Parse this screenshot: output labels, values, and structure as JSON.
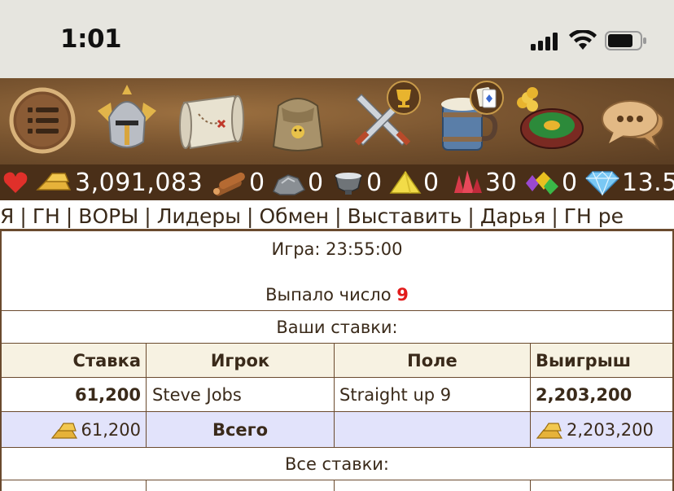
{
  "status_bar": {
    "time": "1:01"
  },
  "toolbar": {
    "icons": [
      "menu-icon",
      "knight-helmet-icon",
      "treasure-map-icon",
      "backpack-icon",
      "crossed-swords-icon",
      "tavern-mug-icon",
      "roulette-icon",
      "chat-icon"
    ],
    "badges": [
      "trophy-badge-icon",
      "cards-badge-icon"
    ]
  },
  "resources": {
    "gold": "3,091,083",
    "wood": "0",
    "stone": "0",
    "mercury": "0",
    "sulfur": "0",
    "crystal": "30",
    "gems": "0",
    "diamonds": "13.5"
  },
  "nav": {
    "items": [
      "Я",
      "ГН",
      "ВОРЫ",
      "Лидеры",
      "Обмен",
      "Выставить",
      "Дарья",
      "ГН ре"
    ]
  },
  "game": {
    "time_label": "Игра: 23:55:00",
    "result_label": "Выпало число",
    "result_number": "9"
  },
  "your_bets_title": "Ваши ставки:",
  "table": {
    "headers": [
      "Ставка",
      "Игрок",
      "Поле",
      "Выигрыш"
    ],
    "rows": [
      {
        "bet": "61,200",
        "player": "Steve Jobs",
        "field": "Straight up 9",
        "win": "2,203,200"
      }
    ],
    "total": {
      "bet": "61,200",
      "label": "Всего",
      "win": "2,203,200"
    }
  },
  "all_bets_title": "Все ставки:",
  "colors": {
    "header_bg": "#f7f2e2",
    "total_bg": "#e2e3fb",
    "result_number": "#e21b1b",
    "resource_bar": "#4a2f18"
  }
}
